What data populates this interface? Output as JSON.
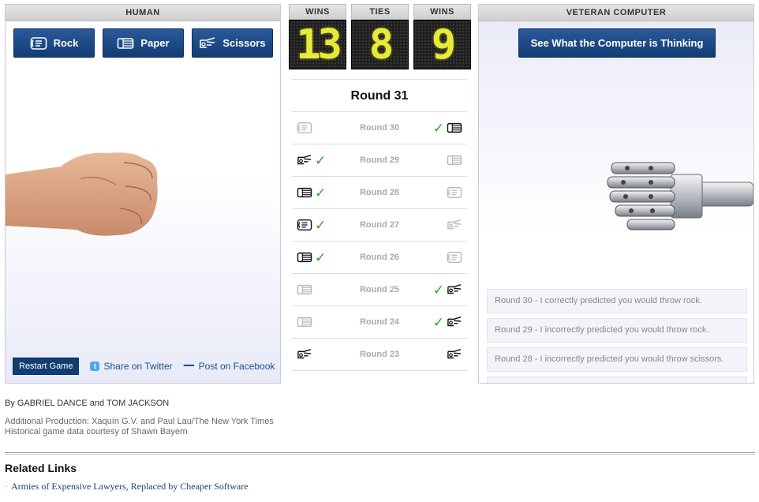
{
  "human": {
    "header": "HUMAN",
    "buttons": [
      {
        "label": "Rock",
        "icon": "rock-hand-icon"
      },
      {
        "label": "Paper",
        "icon": "paper-hand-icon"
      },
      {
        "label": "Scissors",
        "icon": "scissors-hand-icon"
      }
    ],
    "restart_label": "Restart Game",
    "twitter_label": "Share on Twitter",
    "facebook_label": "Post on Facebook"
  },
  "scoreboard": {
    "wins_human": {
      "label": "WINS",
      "value": "13"
    },
    "ties": {
      "label": "TIES",
      "value": "8"
    },
    "wins_computer": {
      "label": "WINS",
      "value": "9"
    }
  },
  "rounds": {
    "current": "Round 31",
    "history": [
      {
        "label": "Round 30",
        "human": "rock",
        "computer": "paper",
        "winner": "computer"
      },
      {
        "label": "Round 29",
        "human": "scissors",
        "computer": "paper",
        "winner": "human"
      },
      {
        "label": "Round 28",
        "human": "paper",
        "computer": "rock",
        "winner": "human"
      },
      {
        "label": "Round 27",
        "human": "rock",
        "computer": "scissors",
        "winner": "human"
      },
      {
        "label": "Round 26",
        "human": "paper",
        "computer": "rock",
        "winner": "human"
      },
      {
        "label": "Round 25",
        "human": "paper",
        "computer": "scissors",
        "winner": "computer"
      },
      {
        "label": "Round 24",
        "human": "paper",
        "computer": "scissors",
        "winner": "computer"
      },
      {
        "label": "Round 23",
        "human": "scissors",
        "computer": "scissors",
        "winner": "tie"
      }
    ]
  },
  "computer": {
    "header": "VETERAN COMPUTER",
    "think_label": "See What the Computer is Thinking",
    "messages": [
      "Round 30 - I correctly predicted you would throw rock.",
      "Round 29 - I incorrectly predicted you would throw rock.",
      "Round 28 - I incorrectly predicted you would throw scissors."
    ]
  },
  "credits": {
    "byline": "By GABRIEL DANCE and TOM JACKSON",
    "line1": "Additional Production: Xaquín G.V. and Paul Lau/The New York Times",
    "line2": "Historical game data courtesy of Shawn Bayern"
  },
  "related": {
    "title": "Related Links",
    "links": [
      "Armies of Expensive Lawyers, Replaced by Cheaper Software"
    ]
  },
  "colors": {
    "button_blue": "#123c74",
    "check_green": "#1faa1f",
    "digit_yellow": "#e8ea3a"
  }
}
